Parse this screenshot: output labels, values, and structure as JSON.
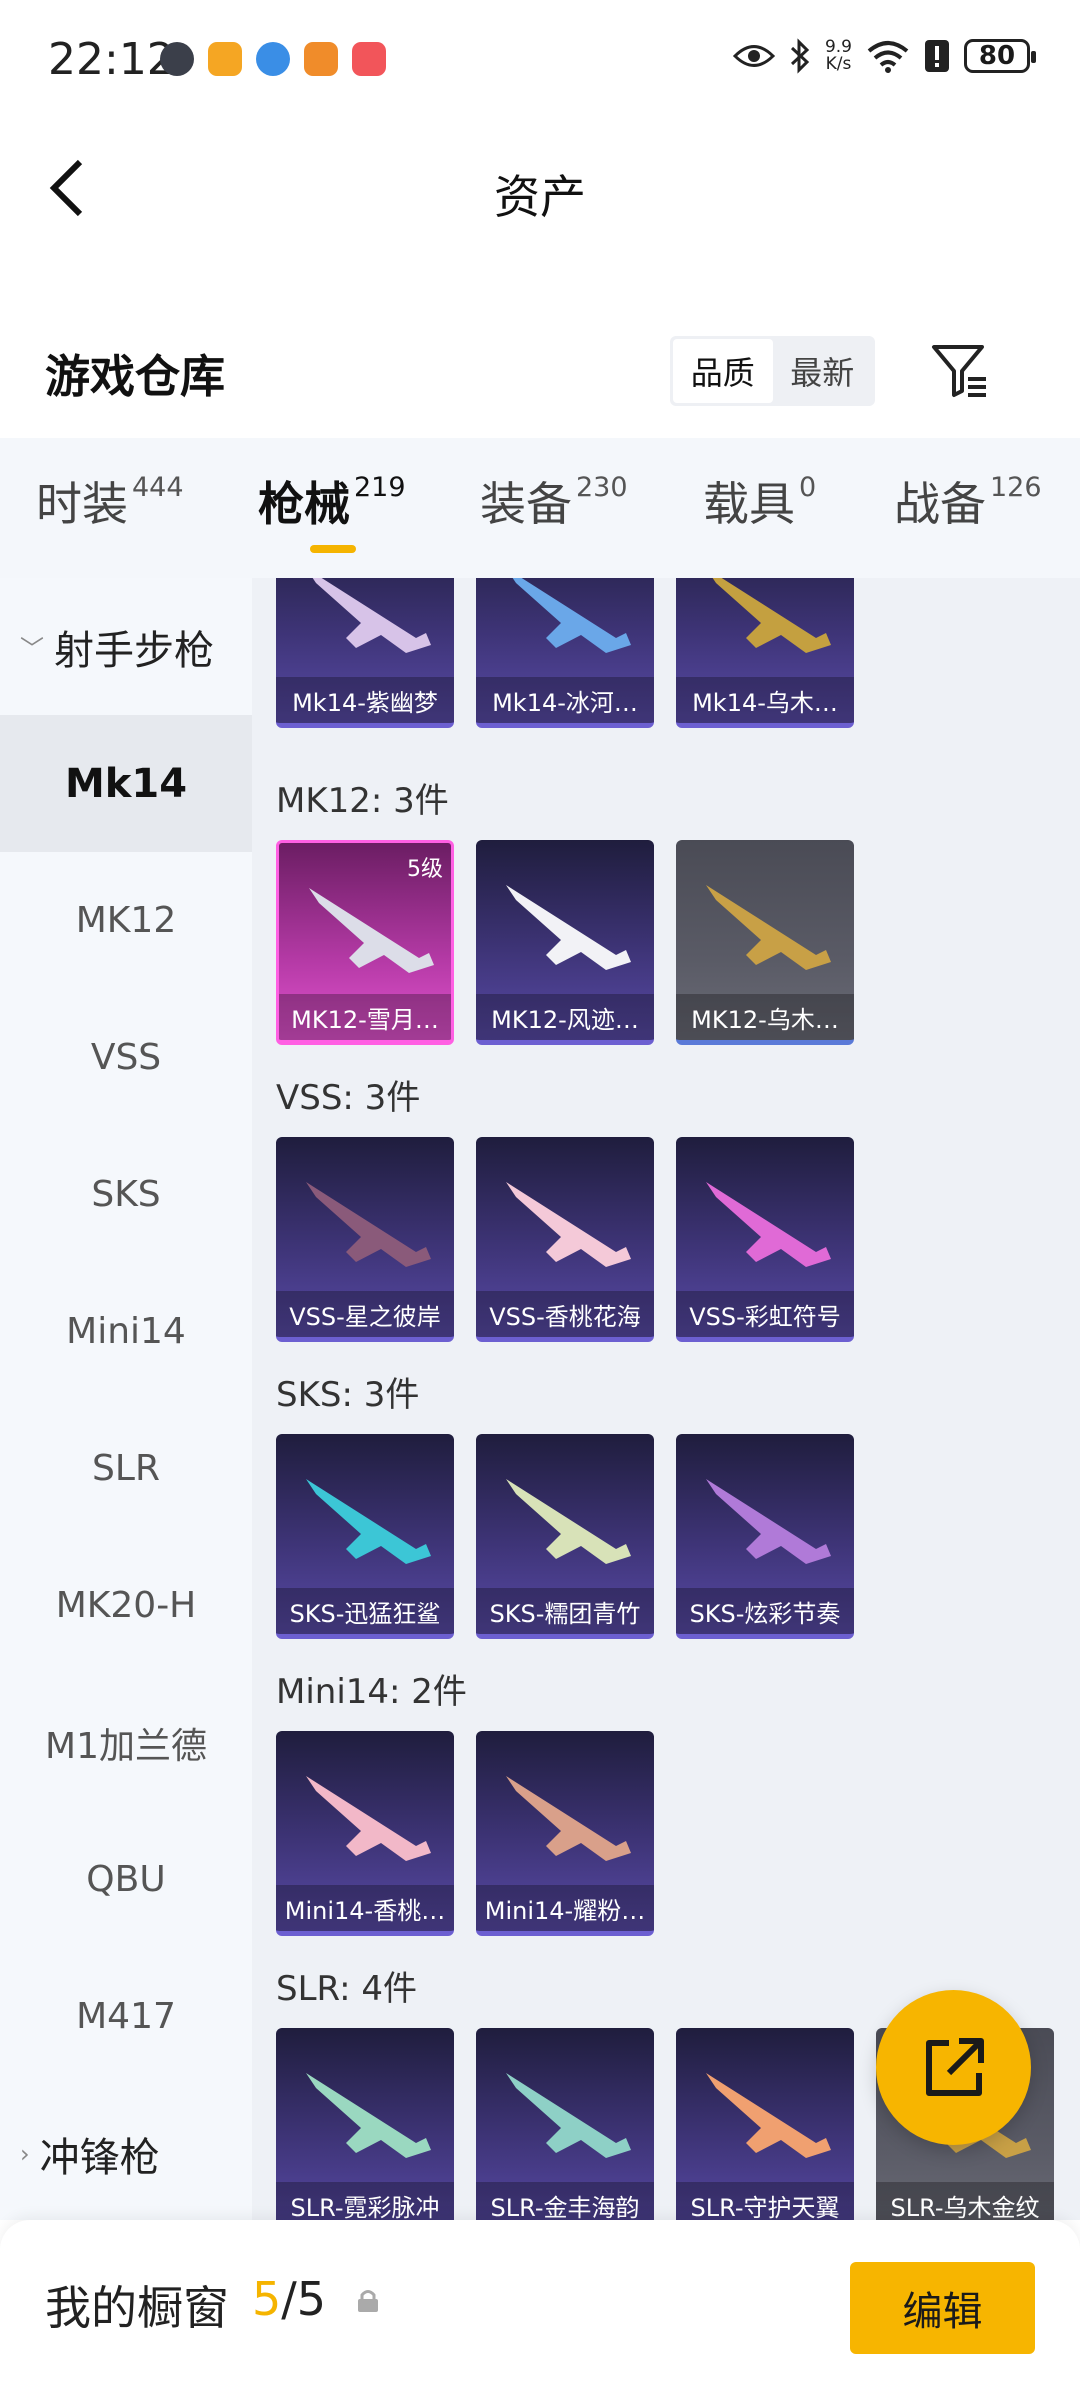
{
  "status_bar": {
    "time": "22:12",
    "net_speed_value": "9.9",
    "net_speed_unit": "K/s",
    "battery": "80"
  },
  "header": {
    "title": "资产"
  },
  "warehouse": {
    "title": "游戏仓库",
    "sort_options": [
      "品质",
      "最新"
    ],
    "active_sort": "品质"
  },
  "tabs": [
    {
      "label": "时装",
      "count": "444"
    },
    {
      "label": "枪械",
      "count": "219"
    },
    {
      "label": "装备",
      "count": "230"
    },
    {
      "label": "载具",
      "count": "0"
    },
    {
      "label": "战备",
      "count": "126"
    }
  ],
  "active_tab": "枪械",
  "sidebar": {
    "group_top": "射手步枪",
    "items": [
      "Mk14",
      "MK12",
      "VSS",
      "SKS",
      "Mini14",
      "SLR",
      "MK20-H",
      "M1加兰德",
      "QBU",
      "M417"
    ],
    "active_item": "Mk14",
    "group_bottom": "冲锋枪"
  },
  "sections": [
    {
      "title": "",
      "cards": [
        {
          "label": "Mk14-紫幽梦",
          "style": "purple"
        },
        {
          "label": "Mk14-冰河…",
          "style": "purple"
        },
        {
          "label": "Mk14-乌木…",
          "style": "purple"
        }
      ]
    },
    {
      "title": "MK12: 3件",
      "cards": [
        {
          "label": "MK12-雪月…",
          "style": "pink",
          "badge": "5级"
        },
        {
          "label": "MK12-风迹…",
          "style": "purple"
        },
        {
          "label": "MK12-乌木…",
          "style": "gray"
        }
      ]
    },
    {
      "title": "VSS: 3件",
      "cards": [
        {
          "label": "VSS-星之彼岸",
          "style": "purple"
        },
        {
          "label": "VSS-香桃花海",
          "style": "purple"
        },
        {
          "label": "VSS-彩虹符号",
          "style": "purple"
        }
      ]
    },
    {
      "title": "SKS: 3件",
      "cards": [
        {
          "label": "SKS-迅猛狂鲨",
          "style": "purple"
        },
        {
          "label": "SKS-糯团青竹",
          "style": "purple"
        },
        {
          "label": "SKS-炫彩节奏",
          "style": "purple"
        }
      ]
    },
    {
      "title": "Mini14: 2件",
      "cards": [
        {
          "label": "Mini14-香桃…",
          "style": "purple"
        },
        {
          "label": "Mini14-耀粉…",
          "style": "purple"
        }
      ]
    },
    {
      "title": "SLR: 4件",
      "cards": [
        {
          "label": "SLR-霓彩脉冲",
          "style": "purple"
        },
        {
          "label": "SLR-金丰海韵",
          "style": "purple"
        },
        {
          "label": "SLR-守护天翼",
          "style": "purple"
        },
        {
          "label": "SLR-乌木金纹",
          "style": "gray"
        }
      ]
    }
  ],
  "bottom_bar": {
    "label": "我的橱窗",
    "current": "5",
    "separator": "/",
    "total": "5",
    "edit": "编辑"
  },
  "colors": {
    "accent": "#f7b500",
    "card_purple": "#3e3477",
    "card_pink": "#e253cf",
    "card_gray": "#5a5b66"
  }
}
